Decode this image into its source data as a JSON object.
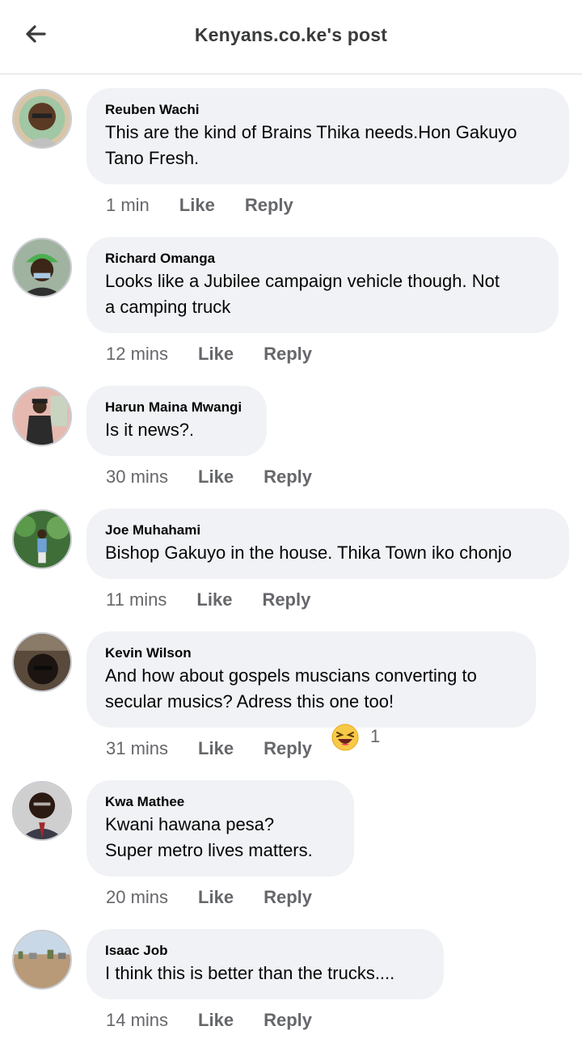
{
  "header": {
    "title": "Kenyans.co.ke's post",
    "back_icon": "arrow-left-icon"
  },
  "actions": {
    "like": "Like",
    "reply": "Reply"
  },
  "comments": [
    {
      "author": "Reuben Wachi",
      "text": "This are the kind of Brains Thika needs.Hon Gakuyo\nTano Fresh.",
      "time": "1 min"
    },
    {
      "author": "Richard Omanga",
      "text": "Looks like a Jubilee campaign vehicle though. Not\na camping truck",
      "time": "12 mins"
    },
    {
      "author": "Harun Maina Mwangi",
      "text": "Is it news?.",
      "time": "30 mins"
    },
    {
      "author": "Joe Muhahami",
      "text": "Bishop Gakuyo in the house. Thika Town iko chonjo",
      "time": "11 mins"
    },
    {
      "author": "Kevin Wilson",
      "text": "And how about gospels muscians converting to\nsecular musics? Adress this one too!",
      "time": "31 mins",
      "reaction": {
        "icon": "laughing-emoji-icon",
        "count": "1"
      }
    },
    {
      "author": "Kwa Mathee",
      "text": "Kwani hawana pesa?\nSuper metro lives matters.",
      "time": "20 mins"
    },
    {
      "author": "Isaac Job",
      "text": "I think this is better than the trucks....",
      "time": "14 mins"
    }
  ],
  "colors": {
    "bubble": "#f0f2f5",
    "secondary_text": "#65676b",
    "divider": "#dadde1"
  }
}
